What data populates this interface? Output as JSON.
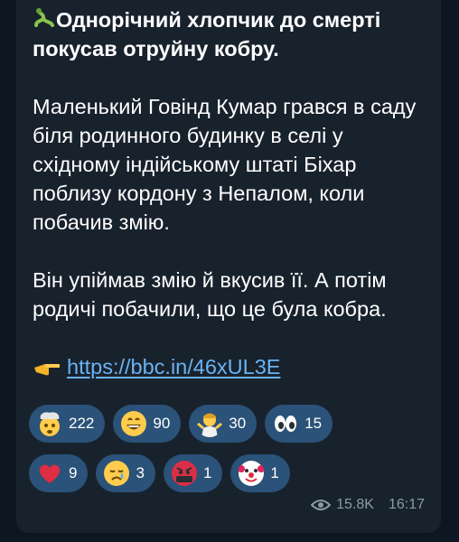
{
  "message": {
    "title": "Однорічний хлопчик до смерті покусав отруйну кобру.",
    "paragraph1": "Маленький Говінд Кумар грався в саду біля родинного будинку в селі у східному індійському штаті Біхар поблизу кордону з Непалом, коли побачив змію.",
    "paragraph2": "Він упіймав змію й вкусив її. А потім родичі побачили, що це була кобра.",
    "link": "https://bbc.in/46xUL3E",
    "title_icon": "snake-icon",
    "link_icon": "pointing-hand-icon"
  },
  "reactions": [
    {
      "icon": "exploding-head-icon",
      "count": "222"
    },
    {
      "icon": "grinning-face-icon",
      "count": "90"
    },
    {
      "icon": "shrug-person-icon",
      "count": "30"
    },
    {
      "icon": "eyes-icon",
      "count": "15"
    },
    {
      "icon": "red-heart-icon",
      "count": "9"
    },
    {
      "icon": "crying-face-icon",
      "count": "3"
    },
    {
      "icon": "cursing-face-icon",
      "count": "1"
    },
    {
      "icon": "clown-face-icon",
      "count": "1"
    }
  ],
  "meta": {
    "views": "15.8K",
    "time": "16:17"
  },
  "colors": {
    "bubble": "#18222d",
    "background": "#0e1621",
    "link": "#6ab3f3",
    "reaction_pill": "#2b5278"
  }
}
